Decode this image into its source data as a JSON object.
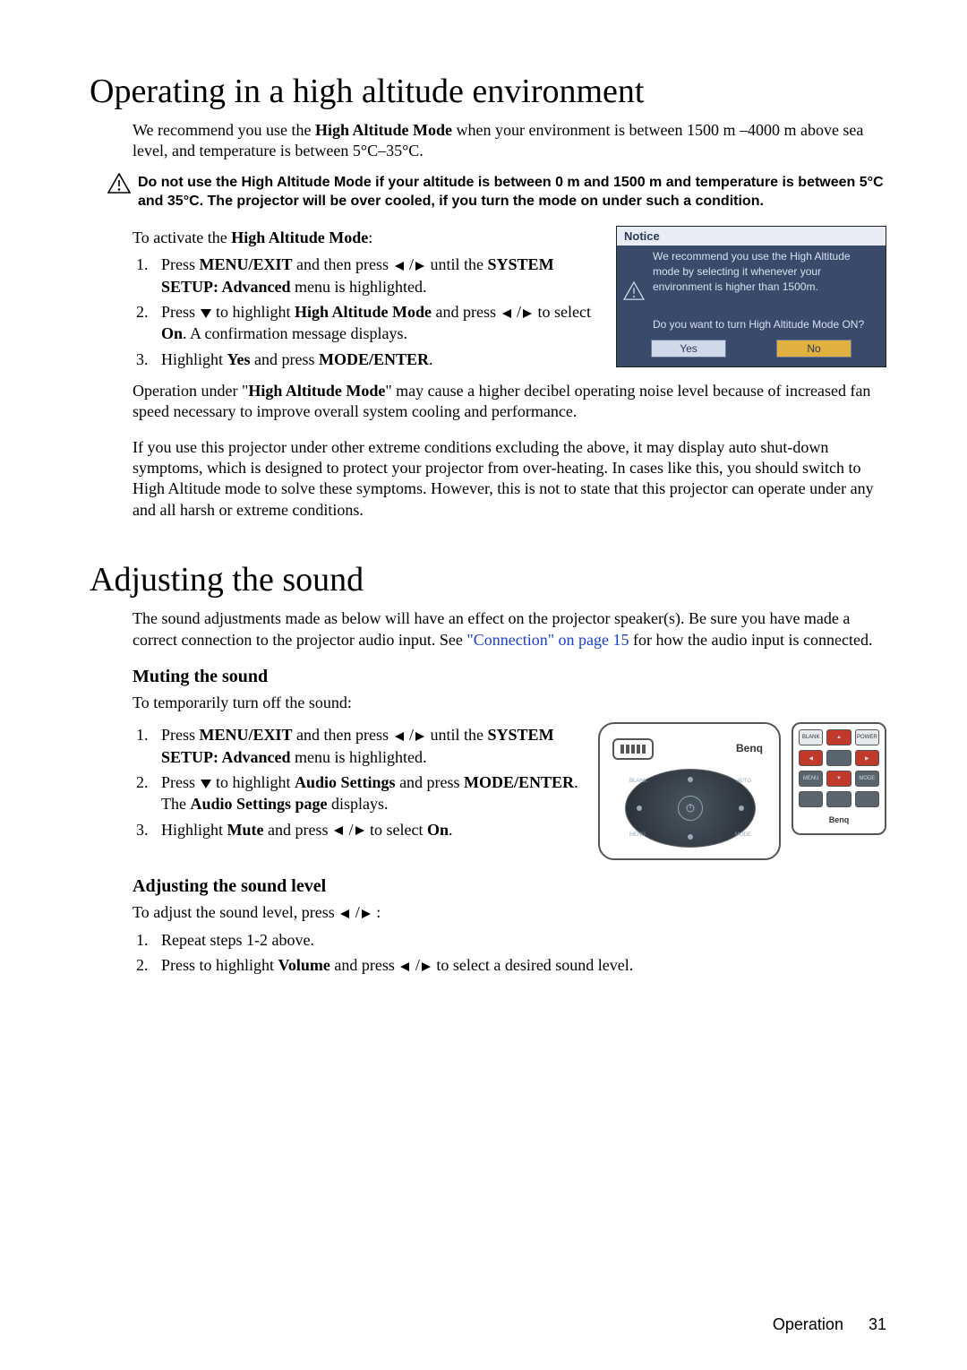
{
  "section1": {
    "title": "Operating in a high altitude environment",
    "intro_pre": "We recommend you use the ",
    "intro_bold": "High Altitude Mode",
    "intro_post": " when your environment is between 1500 m –4000 m above sea level, and temperature is between 5°C–35°C.",
    "warning": "Do not use the High Altitude Mode if your altitude is between 0 m and 1500 m and temperature is between 5°C and 35°C. The projector will be over cooled, if you turn the mode on under such a condition.",
    "activate_pre": "To activate the ",
    "activate_bold": "High Altitude Mode",
    "activate_post": ":",
    "step1_a": "Press ",
    "step1_b": "MENU/EXIT",
    "step1_c": " and then press ",
    "step1_d": " until the ",
    "step1_e": "SYSTEM SETUP: Advanced",
    "step1_f": " menu is highlighted.",
    "step2_a": "Press ",
    "step2_b": " to highlight ",
    "step2_c": "High Altitude Mode",
    "step2_d": " and press ",
    "step2_e": " to select ",
    "step2_f": "On",
    "step2_g": ". A confirmation message displays.",
    "step3_a": "Highlight ",
    "step3_b": "Yes",
    "step3_c": " and press ",
    "step3_d": "MODE/ENTER",
    "step3_e": ".",
    "para2_a": "Operation under \"",
    "para2_b": "High Altitude Mode",
    "para2_c": "\" may cause a higher decibel operating noise level because of increased fan speed necessary to improve overall system cooling and performance.",
    "para3": "If you use this projector under other extreme conditions excluding the above, it may display auto shut-down symptoms, which is designed to protect your projector from over-heating. In cases like this, you should switch to High Altitude mode to solve these symptoms. However, this is not to state that this projector can operate under any and all harsh or extreme conditions."
  },
  "notice": {
    "title": "Notice",
    "line1": "We recommend you use the High Altitude mode by selecting it whenever your environment is higher than 1500m.",
    "line2": "Do you want to turn High Altitude Mode ON?",
    "yes": "Yes",
    "no": "No"
  },
  "section2": {
    "title": "Adjusting the sound",
    "intro_a": "The sound adjustments made as below will have an effect on the projector speaker(s). Be sure you have made a correct connection to the projector audio input. See ",
    "intro_link": "\"Connection\" on page 15",
    "intro_b": " for how the audio input is connected.",
    "sub1": "Muting the sound",
    "sub1_intro": "To temporarily turn off the sound:",
    "s1_a": "Press ",
    "s1_b": "MENU/EXIT",
    "s1_c": " and then press ",
    "s1_d": " until the ",
    "s1_e": "SYSTEM SETUP: Advanced",
    "s1_f": " menu is highlighted.",
    "s2_a": "Press ",
    "s2_b": " to highlight ",
    "s2_c": "Audio Settings",
    "s2_d": " and press ",
    "s2_e": "MODE/ENTER",
    "s2_f": ". The ",
    "s2_g": "Audio Settings page",
    "s2_h": " displays.",
    "s3_a": "Highlight ",
    "s3_b": "Mute",
    "s3_c": " and press ",
    "s3_d": " to select ",
    "s3_e": "On",
    "s3_f": ".",
    "sub2": "Adjusting the sound level",
    "sub2_intro_a": "To adjust the sound level, press ",
    "sub2_intro_b": " :",
    "l1": "Repeat steps 1-2 above.",
    "l2_a": "Press to highlight ",
    "l2_b": "Volume",
    "l2_c": " and press ",
    "l2_d": " to select a desired sound level."
  },
  "devices": {
    "logo": "Benq",
    "remote_brand": "Benq"
  },
  "footer": {
    "section": "Operation",
    "page": "31"
  }
}
